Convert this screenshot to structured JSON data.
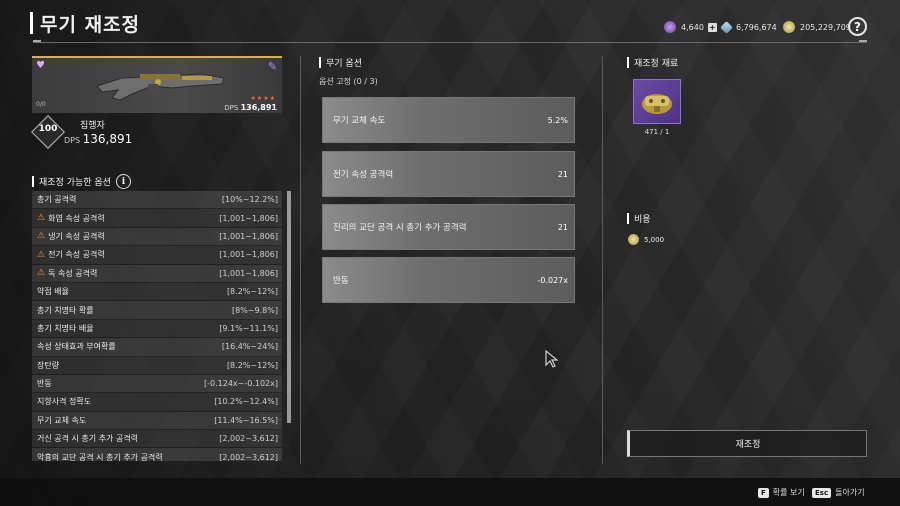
{
  "header": {
    "title": "무기 재조정",
    "currencies": [
      {
        "icon": "purple-orb-icon",
        "value": "4,640",
        "color": "#a66be0"
      },
      {
        "icon": "blue-crystal-icon",
        "value": "6,796,674",
        "color": "#7fb6d8"
      },
      {
        "icon": "gold-coin-icon",
        "value": "205,229,709",
        "color": "#d8c270"
      }
    ],
    "help": "?"
  },
  "weapon": {
    "level_small": "0/0",
    "dps_label": "DPS",
    "dps_value": "136,891",
    "stars": "★★★★",
    "level": "100",
    "name": "집행자"
  },
  "options_panel": {
    "title": "재조정 가능한 옵션",
    "info": "i",
    "rows": [
      {
        "label": "총기 공격력",
        "range": "[10%~12.2%]",
        "warn": false
      },
      {
        "label": "화염 속성 공격력",
        "range": "[1,001~1,806]",
        "warn": true
      },
      {
        "label": "냉기 속성 공격력",
        "range": "[1,001~1,806]",
        "warn": true
      },
      {
        "label": "전기 속성 공격력",
        "range": "[1,001~1,806]",
        "warn": true
      },
      {
        "label": "독 속성 공격력",
        "range": "[1,001~1,806]",
        "warn": true
      },
      {
        "label": "약점 배율",
        "range": "[8.2%~12%]",
        "warn": false
      },
      {
        "label": "총기 치명타 확률",
        "range": "[8%~9.8%]",
        "warn": false
      },
      {
        "label": "총기 치명타 배율",
        "range": "[9.1%~11.1%]",
        "warn": false
      },
      {
        "label": "속성 상태효과 부여확률",
        "range": "[16.4%~24%]",
        "warn": false
      },
      {
        "label": "장탄량",
        "range": "[8.2%~12%]",
        "warn": false
      },
      {
        "label": "반동",
        "range": "[-0.124x~-0.102x]",
        "warn": false
      },
      {
        "label": "지향사격 정확도",
        "range": "[10.2%~12.4%]",
        "warn": false
      },
      {
        "label": "무기 교체 속도",
        "range": "[11.4%~16.5%]",
        "warn": false
      },
      {
        "label": "거신 공격 시 총기 추가 공격력",
        "range": "[2,002~3,612]",
        "warn": false
      },
      {
        "label": "악흉의 교단 공격 시 총기 추가 공격력",
        "range": "[2,002~3,612]",
        "warn": false
      }
    ]
  },
  "weapon_options": {
    "title": "무기 옵션",
    "subtitle": "옵션 고정 (0 / 3)",
    "items": [
      {
        "label": "무기 교체 속도",
        "value": "5.2%"
      },
      {
        "label": "전기 속성 공격력",
        "value": "21"
      },
      {
        "label": "진리의 교단 공격 시 총기 추가 공격력",
        "value": "21"
      },
      {
        "label": "반동",
        "value": "-0.027x"
      }
    ]
  },
  "materials": {
    "title": "재조정 재료",
    "count": "471 / 1",
    "item_icon": "reforge-material-icon"
  },
  "cost": {
    "title": "비용",
    "value": "5,000"
  },
  "reforge_button": "재조정",
  "footer": {
    "keys": [
      {
        "key": "F",
        "label": "확률 보기"
      },
      {
        "key": "Esc",
        "label": "돌아가기"
      }
    ]
  }
}
